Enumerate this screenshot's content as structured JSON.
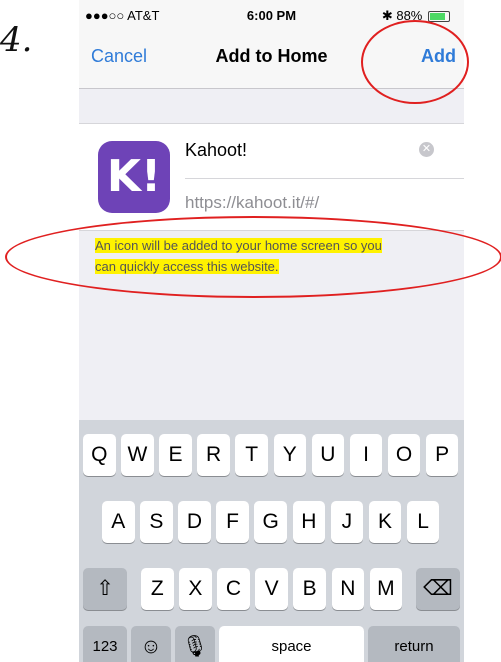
{
  "annotation": {
    "step_mark": "4."
  },
  "status_bar": {
    "carrier": "●●●○○ AT&T",
    "time": "6:00 PM",
    "battery": "88%"
  },
  "nav": {
    "cancel": "Cancel",
    "title": "Add to Home",
    "add": "Add"
  },
  "app": {
    "icon_text": "K!",
    "name": "Kahoot!",
    "url": "https://kahoot.it/#/",
    "icon_color": "#6e43b7"
  },
  "hint": "An icon will be added to your home screen so you can quickly access this website.",
  "keyboard": {
    "row1": [
      "Q",
      "W",
      "E",
      "R",
      "T",
      "Y",
      "U",
      "I",
      "O",
      "P"
    ],
    "row2": [
      "A",
      "S",
      "D",
      "F",
      "G",
      "H",
      "J",
      "K",
      "L"
    ],
    "row3": [
      "Z",
      "X",
      "C",
      "V",
      "B",
      "N",
      "M"
    ],
    "numbers": "123",
    "space": "space",
    "return": "return"
  }
}
